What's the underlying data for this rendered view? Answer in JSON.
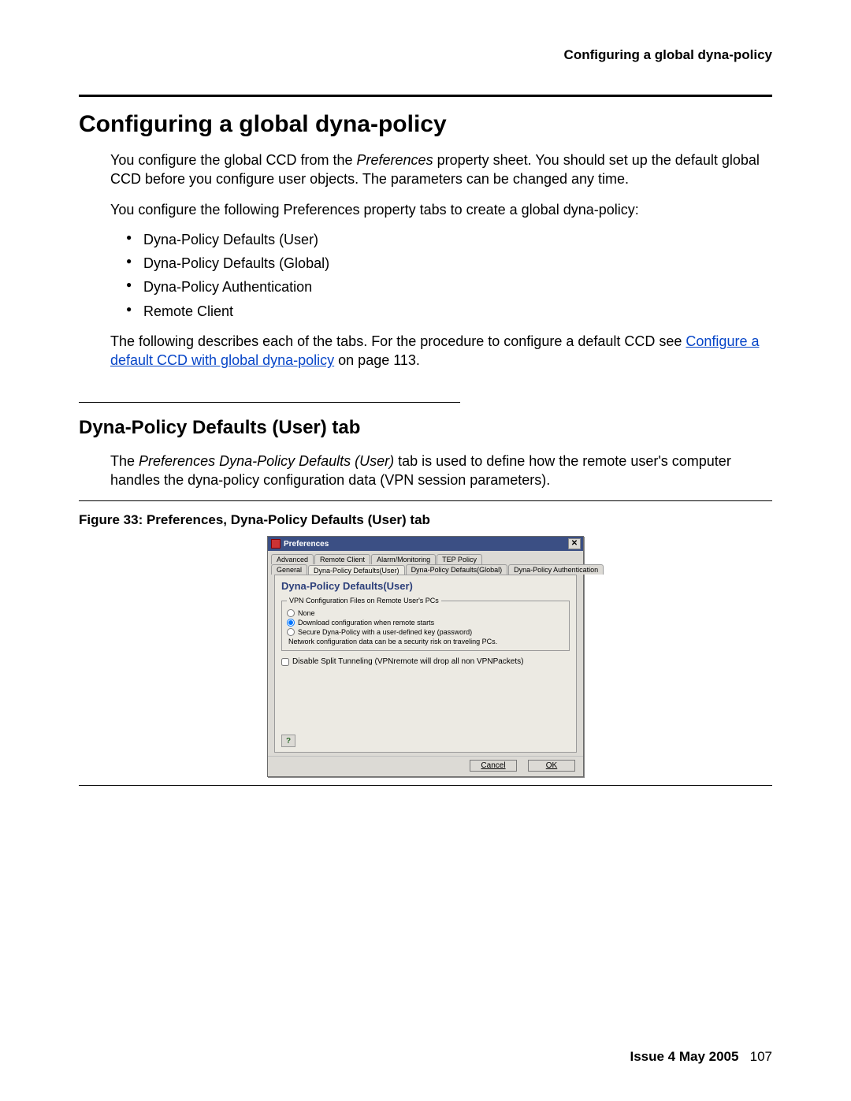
{
  "header": {
    "running": "Configuring a global dyna-policy"
  },
  "h1": "Configuring a global dyna-policy",
  "p1a": "You configure the global CCD from the ",
  "p1_em": "Preferences",
  "p1b": " property sheet. You should set up the default global CCD before you configure user objects. The parameters can be changed any time.",
  "p2": "You configure the following Preferences property tabs to create a global dyna-policy:",
  "bullets": [
    "Dyna-Policy Defaults (User)",
    "Dyna-Policy Defaults (Global)",
    "Dyna-Policy Authentication",
    "Remote Client"
  ],
  "p3a": "The following describes each of the tabs. For the procedure to configure a default CCD see ",
  "p3_link": "Configure a default CCD with global dyna-policy",
  "p3b": " on page 113.",
  "h2": "Dyna-Policy Defaults (User) tab",
  "p4a": "The ",
  "p4_em": "Preferences Dyna-Policy Defaults (User)",
  "p4b": " tab is used to define how the remote user's computer handles the dyna-policy configuration data (VPN session parameters).",
  "fig_caption": "Figure 33: Preferences, Dyna-Policy Defaults (User) tab",
  "dialog": {
    "title": "Preferences",
    "tabs_row1": [
      "Advanced",
      "Remote Client",
      "Alarm/Monitoring",
      "TEP Policy"
    ],
    "tabs_row2": [
      "General",
      "Dyna-Policy Defaults(User)",
      "Dyna-Policy Defaults(Global)",
      "Dyna-Policy Authentication"
    ],
    "active_tab": "Dyna-Policy Defaults(User)",
    "pane_title": "Dyna-Policy Defaults(User)",
    "group_legend": "VPN Configuration Files on Remote User's PCs",
    "radios": {
      "none": "None",
      "download": "Download configuration when remote starts",
      "secure": "Secure Dyna-Policy with a user-defined key (password)"
    },
    "radio_selected": "download",
    "group_note": "Network configuration data can be a security risk on traveling PCs.",
    "checkbox_label": "Disable Split Tunneling (VPNremote will drop all non VPNPackets)",
    "buttons": {
      "cancel": "Cancel",
      "ok": "OK"
    },
    "help": "?"
  },
  "footer": {
    "issue": "Issue 4   May 2005",
    "page": "107"
  }
}
